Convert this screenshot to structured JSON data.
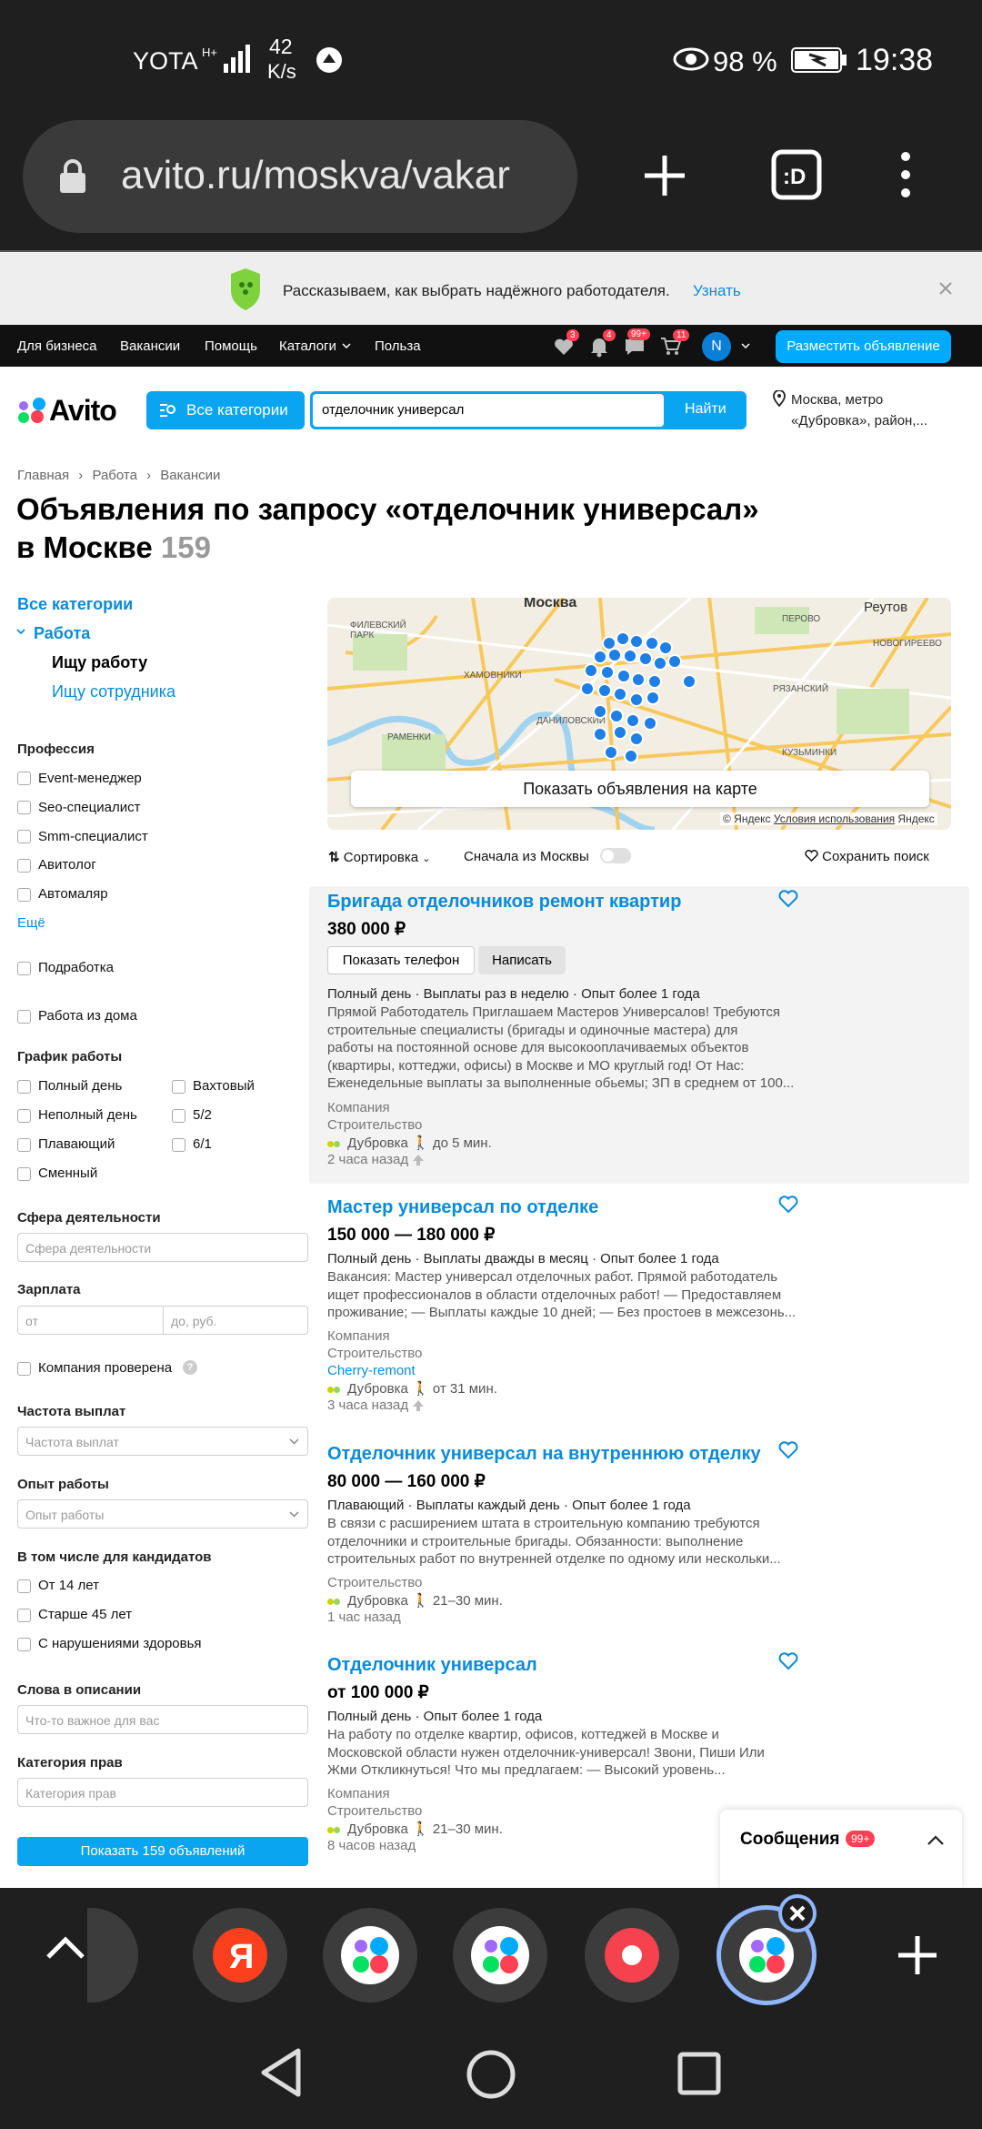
{
  "status_bar": {
    "carrier": "YOTA",
    "net_speed_value": "42",
    "net_speed_unit": "K/s",
    "battery": "98 %",
    "time": "19:38"
  },
  "browser": {
    "url": "avito.ru/moskva/vakar"
  },
  "banner": {
    "text": "Рассказываем, как выбрать надёжного работодателя.",
    "link": "Узнать"
  },
  "topnav": {
    "links": [
      "Для бизнеса",
      "Вакансии",
      "Помощь",
      "Каталоги",
      "Польза"
    ],
    "badges": [
      "3",
      "4",
      "99+",
      "11"
    ],
    "avatar_letter": "N",
    "post_ad": "Разместить объявление"
  },
  "header": {
    "logo": "Avito",
    "categories_button": "Все категории",
    "search_value": "отделочник универсал",
    "search_button": "Найти",
    "location": "Москва, метро «Дубровка», район,..."
  },
  "breadcrumbs": [
    "Главная",
    "Работа",
    "Вакансии"
  ],
  "page_title": {
    "line1": "Объявления по запросу «отделочник универсал»",
    "line2": "в Москве",
    "count": "159"
  },
  "sidebar": {
    "all_categories": "Все категории",
    "category": "Работа",
    "sub_active": "Ищу работу",
    "sub_other": "Ищу сотрудника",
    "profession_title": "Профессия",
    "professions": [
      "Event-менеджер",
      "Seo-специалист",
      "Smm-специалист",
      "Авитолог",
      "Автомаляр"
    ],
    "more": "Ещё",
    "part_time": "Подработка",
    "remote": "Работа из дома",
    "schedule_title": "График работы",
    "schedule_left": [
      "Полный день",
      "Неполный день",
      "Плавающий",
      "Сменный"
    ],
    "schedule_right": [
      "Вахтовый",
      "5/2",
      "6/1"
    ],
    "sphere_title": "Сфера деятельности",
    "sphere_placeholder": "Сфера деятельности",
    "salary_title": "Зарплата",
    "salary_from": "от",
    "salary_to": "до, руб.",
    "verified": "Компания проверена",
    "freq_title": "Частота выплат",
    "freq_placeholder": "Частота выплат",
    "exp_title": "Опыт работы",
    "exp_placeholder": "Опыт работы",
    "candidates_title": "В том числе для кандидатов",
    "candidates": [
      "От 14 лет",
      "Старше 45 лет",
      "С нарушениями здоровья"
    ],
    "words_title": "Слова в описании",
    "words_placeholder": "Что-то важное для вас",
    "license_title": "Категория прав",
    "license_placeholder": "Категория прав",
    "show_button": "Показать 159 объявлений"
  },
  "map": {
    "labels": [
      "Москва",
      "Реутов",
      "ХАМОВНИКИ",
      "ДАНИЛОВСКИЙ",
      "ПЕРОВО",
      "НОВОГИРЕЕВО",
      "КУЗЬМИНКИ",
      "РЯЗАНСКИЙ",
      "ФИЛЕВСКИЙ ПАРК",
      "РАМЕНКИ"
    ],
    "show_on_map": "Показать объявления на карте",
    "copyright": "© Яндекс",
    "terms": "Условия использования",
    "yandex": "Яндекс"
  },
  "controls": {
    "sort": "Сортировка",
    "moscow_first": "Сначала из Москвы",
    "save_search": "Сохранить поиск"
  },
  "listings": [
    {
      "title": "Бригада отделочников ремонт квартир",
      "price": "380 000 ₽",
      "phone_button": "Показать телефон",
      "write_button": "Написать",
      "meta": "Полный день · Выплаты раз в неделю · Опыт более 1 года",
      "desc": [
        "Прямой Работодатель Приглашаем Мастеров Универсалов! Требуются",
        "строительные специалисты (бригады и одиночные мастера) для",
        "работы на постоянной основе для высокооплачиваемых объектов",
        "(квартиры, коттеджи, офисы) в Москве и МО круглый год! От Нас:",
        "Еженедельные выплаты за выполненные обьемы; ЗП в среднем от 100..."
      ],
      "company_type": "Компания",
      "industry": "Строительство",
      "metro": "Дубровка",
      "distance": "до 5 мин.",
      "time": "2 часа назад"
    },
    {
      "title": "Мастер универсал по отделке",
      "price": "150 000 — 180 000 ₽",
      "meta": "Полный день · Выплаты дважды в месяц · Опыт более 1 года",
      "desc": [
        "Вакансия: Мастер универсал отделочных работ. Прямой работодатель",
        "ищет профессионалов в области отделочных работ! — Предоставляем",
        "проживание; — Выплаты каждые 10 дней; — Без простоев в межсезонь..."
      ],
      "company_type": "Компания",
      "industry": "Строительство",
      "company": "Cherry-remont",
      "metro": "Дубровка",
      "distance": "от 31 мин.",
      "time": "3 часа назад"
    },
    {
      "title": "Отделочник универсал на внутреннюю отделку",
      "price": "80 000 — 160 000 ₽",
      "meta": "Плавающий · Выплаты каждый день · Опыт более 1 года",
      "desc": [
        "В связи с расширением штата в строительную компанию требуются",
        "отделочники и строительные бригады. Обязанности: выполнение",
        "строительных работ по внутренней отделке по одному или нескольки..."
      ],
      "industry": "Строительство",
      "metro": "Дубровка",
      "distance": "21–30 мин.",
      "time": "1 час назад"
    },
    {
      "title": "Отделочник универсал",
      "price": "от 100 000 ₽",
      "meta": "Полный день · Опыт более 1 года",
      "desc": [
        "На работу по отделке квартир, офисов, коттеджей в Москве и",
        "Московской области нужен отделочник-универсал! Звони, Пиши Или",
        "Жми Откликнуться! Что мы предлагаем: — Высокий уровень..."
      ],
      "company_type": "Компания",
      "industry": "Строительство",
      "metro": "Дубровка",
      "distance": "21–30 мин.",
      "time": "8 часов назад"
    }
  ],
  "messages": {
    "label": "Сообщения",
    "badge": "99+"
  },
  "colors": {
    "accent": "#0a8bd8",
    "button": "#00aaff",
    "badge": "#ff4053",
    "dark": "#1f1f1f"
  }
}
